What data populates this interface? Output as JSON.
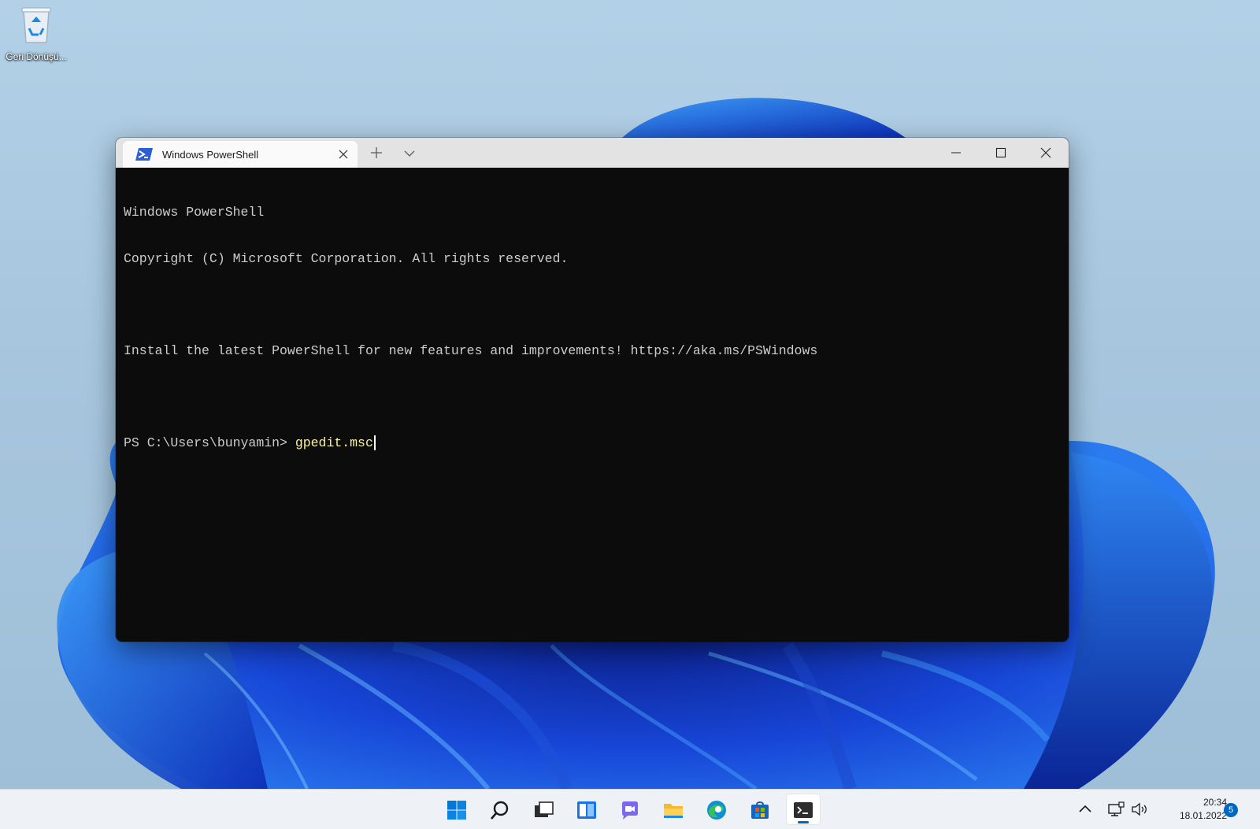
{
  "desktop": {
    "recycle_bin_label": "Geri Dönüşü..."
  },
  "window": {
    "tab_title": "Windows PowerShell"
  },
  "console": {
    "line1": "Windows PowerShell",
    "line2": "Copyright (C) Microsoft Corporation. All rights reserved.",
    "line3": "",
    "line4": "Install the latest PowerShell for new features and improvements! https://aka.ms/PSWindows",
    "line5": "",
    "prompt": "PS C:\\Users\\bunyamin> ",
    "command": "gpedit.msc"
  },
  "taskbar": {
    "apps": [
      "start-icon",
      "search-icon",
      "task-view-icon",
      "widgets-icon",
      "chat-icon",
      "file-explorer-icon",
      "edge-icon",
      "store-icon",
      "terminal-icon"
    ],
    "time": "20:34",
    "date": "18.01.2022",
    "notification_count": "5"
  },
  "colors": {
    "accent": "#0067c0",
    "console_bg": "#0c0c0c",
    "console_text": "#cccccc",
    "command_text": "#f9f1a5",
    "titlebar_bg": "#e3e3e3"
  }
}
